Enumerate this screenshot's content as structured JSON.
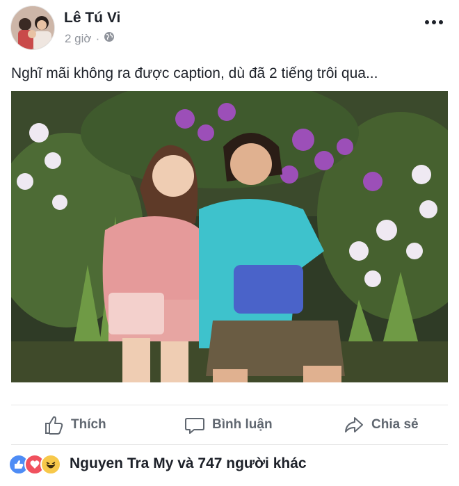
{
  "post": {
    "author": "Lê Tú Vi",
    "time": "2 giờ",
    "separator": "·",
    "privacy_icon": "globe-icon",
    "more_icon": "more-dots-icon",
    "caption": "Nghĩ mãi không ra được caption, dù đã 2 tiếng trôi qua..."
  },
  "actions": {
    "like_label": "Thích",
    "comment_label": "Bình luận",
    "share_label": "Chia sẻ"
  },
  "reactions": {
    "icons": [
      "like-reaction-icon",
      "love-reaction-icon",
      "haha-reaction-icon"
    ],
    "summary": "Nguyen Tra My và 747 người khác"
  },
  "colors": {
    "text": "#1d2129",
    "secondary": "#90949c",
    "action": "#606770",
    "like": "#4e8cf5",
    "love": "#f0515e",
    "haha": "#f7c84a"
  }
}
